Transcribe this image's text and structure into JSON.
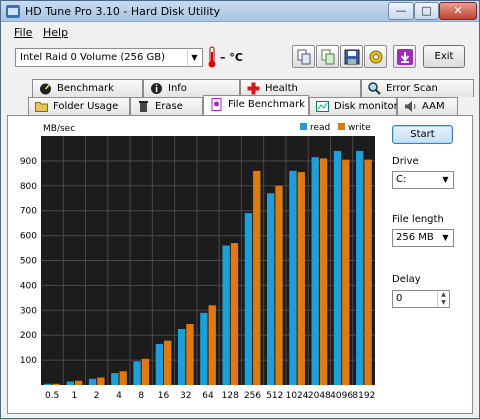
{
  "window": {
    "title": "HD Tune Pro 3.10 - Hard Disk Utility"
  },
  "menu": [
    {
      "label": "File",
      "key": "F"
    },
    {
      "label": "Help",
      "key": "H"
    }
  ],
  "toolbar": {
    "drive": "Intel   Raid 0 Volume (256 GB)",
    "temperature": "– °C",
    "exit_label": "Exit",
    "buttons": [
      "copy-text-icon",
      "copy-screenshot-icon",
      "save-icon",
      "options-icon",
      "download-icon"
    ]
  },
  "tabs_row1": [
    {
      "label": "Benchmark",
      "icon": "benchmark-icon"
    },
    {
      "label": "Info",
      "icon": "info-icon"
    },
    {
      "label": "Health",
      "icon": "health-icon"
    },
    {
      "label": "Error Scan",
      "icon": "error-scan-icon"
    }
  ],
  "tabs_row2": [
    {
      "label": "Folder Usage",
      "icon": "folder-icon"
    },
    {
      "label": "Erase",
      "icon": "erase-icon"
    },
    {
      "label": "File Benchmark",
      "icon": "file-benchmark-icon",
      "active": true
    },
    {
      "label": "Disk monitor",
      "icon": "disk-monitor-icon"
    },
    {
      "label": "AAM",
      "icon": "speaker-icon"
    }
  ],
  "controls": {
    "start_label": "Start",
    "drive_label": "Drive",
    "drive_value": "C:",
    "file_length_label": "File length",
    "file_length_value": "256 MB",
    "delay_label": "Delay",
    "delay_value": "0"
  },
  "chart_data": {
    "type": "bar",
    "ylabel": "MB/sec",
    "ylim": [
      0,
      1000
    ],
    "yticks": [
      100,
      200,
      300,
      400,
      500,
      600,
      700,
      800,
      900
    ],
    "categories": [
      "0.5",
      "1",
      "2",
      "4",
      "8",
      "16",
      "32",
      "64",
      "128",
      "256",
      "512",
      "1024",
      "2048",
      "4096",
      "8192"
    ],
    "series": [
      {
        "name": "read",
        "color": "#1e9fd8",
        "values": [
          5,
          14,
          25,
          48,
          95,
          165,
          225,
          290,
          560,
          690,
          770,
          860,
          915,
          940,
          940
        ]
      },
      {
        "name": "write",
        "color": "#e07a10",
        "values": [
          5,
          17,
          30,
          55,
          105,
          178,
          245,
          320,
          570,
          860,
          800,
          855,
          910,
          905,
          905
        ]
      }
    ],
    "grid": true,
    "legend": "top-right",
    "background": "#1c1c1c"
  }
}
